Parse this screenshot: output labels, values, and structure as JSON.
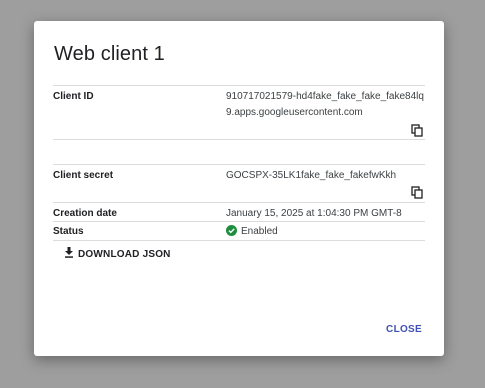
{
  "dialog": {
    "title": "Web client 1",
    "close_label": "CLOSE",
    "download_label": "DOWNLOAD JSON",
    "fields": {
      "client_id": {
        "label": "Client ID",
        "value": "910717021579-hd4fake_fake_fake_fake84lq9.apps.googleusercontent.com",
        "copy_icon": "copy-icon"
      },
      "client_secret": {
        "label": "Client secret",
        "value": "GOCSPX-35LK1fake_fake_fakefwKkh",
        "copy_icon": "copy-icon"
      },
      "creation_date": {
        "label": "Creation date",
        "value": "January 15, 2025 at 1:04:30 PM GMT-8"
      },
      "status": {
        "label": "Status",
        "value": "Enabled",
        "icon": "check-circle-icon",
        "color": "#1e8e3e"
      }
    }
  },
  "colors": {
    "backdrop": "#9e9e9e",
    "accent": "#3f51b5",
    "divider": "#dadce0"
  }
}
